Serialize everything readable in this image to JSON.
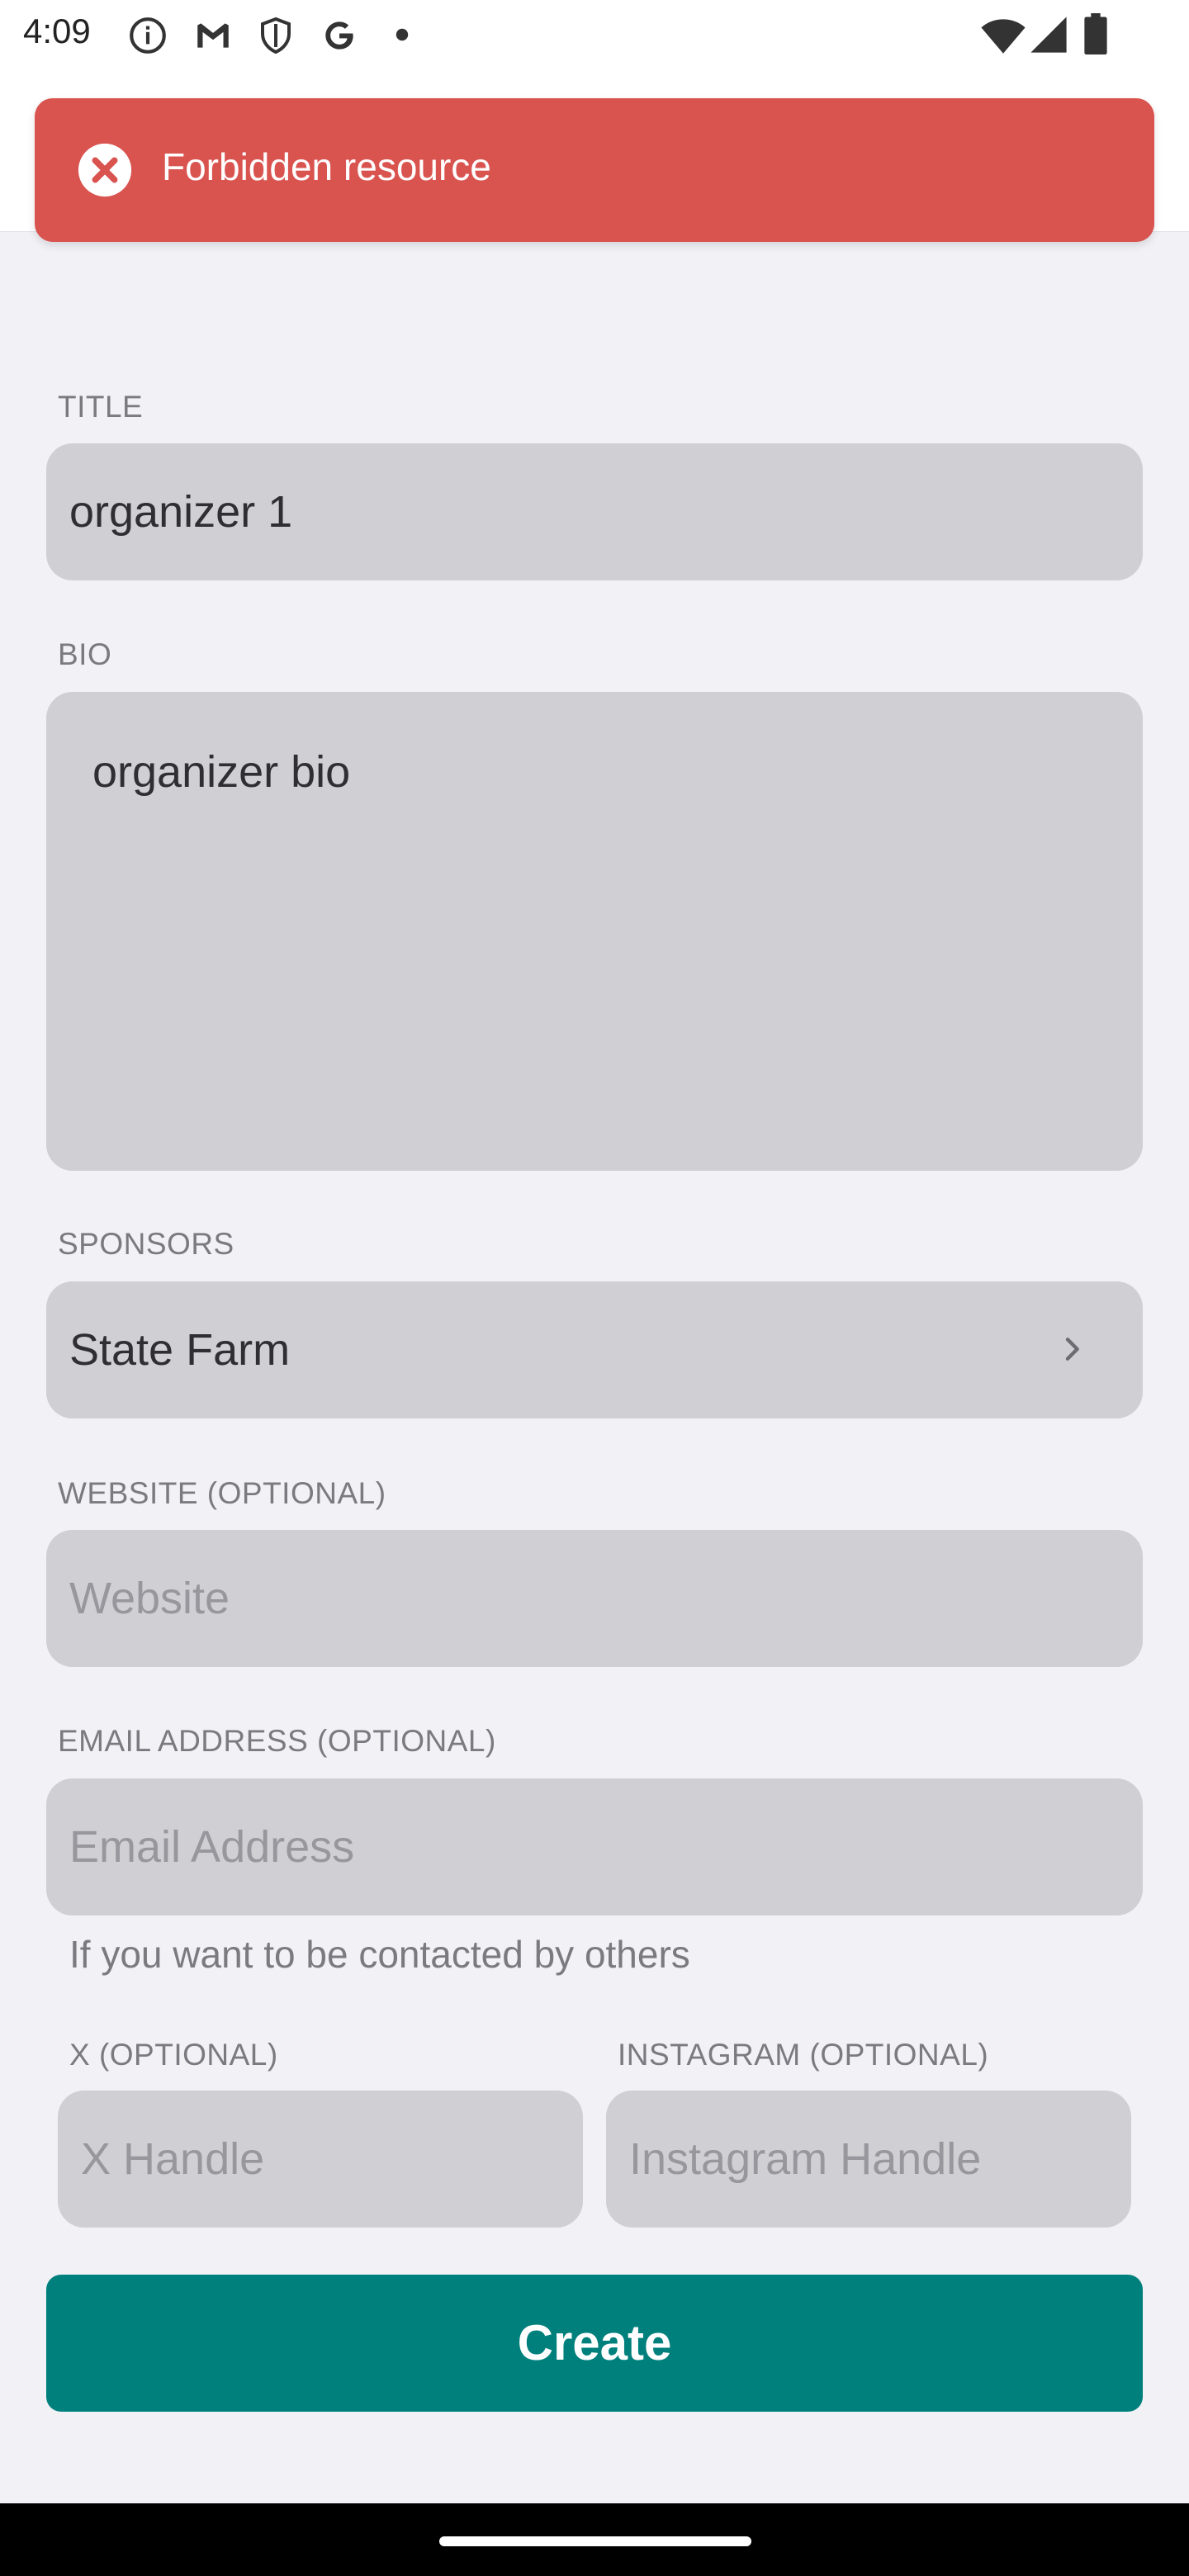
{
  "status_bar": {
    "time": "4:09",
    "icons": [
      "info-circle-icon",
      "gmail-icon",
      "shield-icon",
      "google-icon",
      "dot-icon",
      "wifi-icon",
      "cell-signal-icon",
      "battery-icon"
    ]
  },
  "toast": {
    "icon": "close-circle-icon",
    "message": "Forbidden resource",
    "color": "#d9534f"
  },
  "form": {
    "title": {
      "label": "TITLE",
      "value": "organizer 1"
    },
    "bio": {
      "label": "BIO",
      "value": "organizer bio"
    },
    "sponsors": {
      "label": "SPONSORS",
      "value": "State Farm",
      "icon": "chevron-right-icon"
    },
    "website": {
      "label": "WEBSITE (OPTIONAL)",
      "placeholder": "Website"
    },
    "email": {
      "label": "EMAIL ADDRESS (OPTIONAL)",
      "placeholder": "Email Address",
      "helper": "If you want to be contacted by others"
    },
    "x": {
      "label": "X (OPTIONAL)",
      "placeholder": "X Handle"
    },
    "instagram": {
      "label": "INSTAGRAM (OPTIONAL)",
      "placeholder": "Instagram Handle"
    },
    "submit_label": "Create"
  },
  "colors": {
    "accent": "#00807c",
    "field_bg": "#d0cfd4",
    "page_bg": "#f1f1f6"
  }
}
